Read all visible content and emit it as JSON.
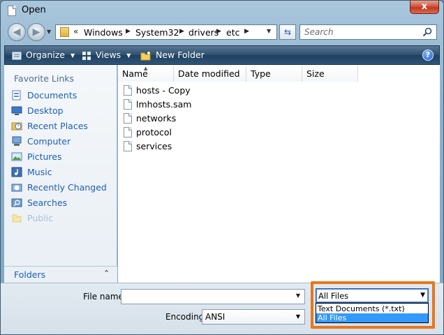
{
  "window": {
    "title": "Open",
    "close_label": "x"
  },
  "nav": {
    "back_glyph": "◀",
    "forward_glyph": "▶",
    "address_prefix": "«",
    "breadcrumb": [
      "Windows",
      "System32",
      "drivers",
      "etc"
    ],
    "search_placeholder": "Search"
  },
  "toolbar": {
    "organize": "Organize",
    "views": "Views",
    "new_folder": "New Folder",
    "help": "?"
  },
  "sidebar": {
    "title": "Favorite Links",
    "items": [
      {
        "label": "Documents",
        "icon": "documents-icon"
      },
      {
        "label": "Desktop",
        "icon": "desktop-icon"
      },
      {
        "label": "Recent Places",
        "icon": "recent-places-icon"
      },
      {
        "label": "Computer",
        "icon": "computer-icon"
      },
      {
        "label": "Pictures",
        "icon": "pictures-icon"
      },
      {
        "label": "Music",
        "icon": "music-icon"
      },
      {
        "label": "Recently Changed",
        "icon": "recently-changed-icon"
      },
      {
        "label": "Searches",
        "icon": "searches-icon"
      },
      {
        "label": "Public",
        "icon": "public-folder-icon"
      }
    ],
    "folders_label": "Folders"
  },
  "columns": [
    "Name",
    "Date modified",
    "Type",
    "Size"
  ],
  "files": [
    "hosts - Copy",
    "lmhosts.sam",
    "networks",
    "protocol",
    "services"
  ],
  "bottom": {
    "file_name_label": "File name:",
    "file_name_value": "",
    "encoding_label": "Encoding:",
    "encoding_value": "ANSI",
    "file_type_value": "All Files",
    "file_type_options": [
      "Text Documents (*.txt)",
      "All Files"
    ],
    "selected_option_index": 1
  },
  "colors": {
    "highlight_border": "#e8771b",
    "link": "#1d5fb4",
    "selection": "#3399ff"
  }
}
